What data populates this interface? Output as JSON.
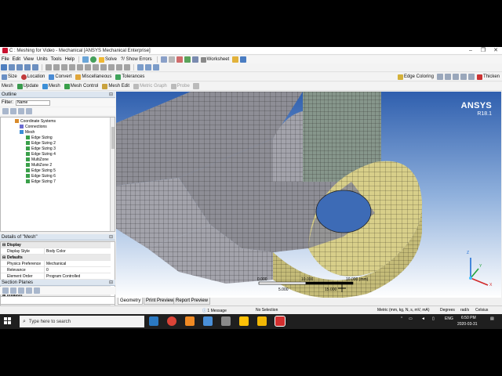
{
  "window": {
    "title": "C : Meshing for Video - Mechanical [ANSYS Mechanical Enterprise]",
    "controls": [
      "–",
      "❐",
      "✕"
    ]
  },
  "menubar": [
    "File",
    "Edit",
    "View",
    "Units",
    "Tools",
    "Help"
  ],
  "toolbar1": {
    "solve": "Solve",
    "show_errors": "?/ Show Errors",
    "worksheet": "Worksheet"
  },
  "toolbar2": {
    "size": "Size",
    "location": "Location",
    "convert": "Convert",
    "miscellaneous": "Miscellaneous",
    "tolerances": "Tolerances",
    "edge_coloring": "Edge Coloring",
    "thicken": "Thicken"
  },
  "toolbar3": {
    "mesh": "Mesh",
    "update": "Update",
    "mesh_menu": "Mesh",
    "mesh_control": "Mesh Control",
    "mesh_edit": "Mesh Edit",
    "metric_graph": "Metric Graph",
    "probe": "Probe"
  },
  "outline": {
    "title": "Outline",
    "filter_label": "Filter:",
    "filter_value": "Name",
    "nodes": [
      {
        "label": "Coordinate Systems",
        "color": "#d88a2b"
      },
      {
        "label": "Connections",
        "color": "#6b6bd1"
      },
      {
        "label": "Mesh",
        "color": "#3d8fd6"
      },
      {
        "label": "Edge Sizing",
        "color": "#3aa04a"
      },
      {
        "label": "Edge Sizing 2",
        "color": "#3aa04a"
      },
      {
        "label": "Edge Sizing 3",
        "color": "#3aa04a"
      },
      {
        "label": "Edge Sizing 4",
        "color": "#3aa04a"
      },
      {
        "label": "MultiZone",
        "color": "#3aa04a"
      },
      {
        "label": "MultiZone 2",
        "color": "#3aa04a"
      },
      {
        "label": "Edge Sizing 5",
        "color": "#3aa04a"
      },
      {
        "label": "Edge Sizing 6",
        "color": "#3aa04a"
      },
      {
        "label": "Edge Sizing 7",
        "color": "#3aa04a"
      }
    ]
  },
  "details": {
    "title": "Details of \"Mesh\"",
    "rows": [
      {
        "type": "section",
        "label": "Display",
        "expander": "⊟"
      },
      {
        "type": "prop",
        "key": "Display Style",
        "value": "Body Color"
      },
      {
        "type": "section",
        "label": "Defaults",
        "expander": "⊟"
      },
      {
        "type": "prop",
        "key": "Physics Preference",
        "value": "Mechanical"
      },
      {
        "type": "prop",
        "key": "Relevance",
        "value": "0"
      },
      {
        "type": "prop",
        "key": "Element Order",
        "value": "Program Controlled"
      },
      {
        "type": "section",
        "label": "Sizing",
        "expander": "⊞"
      },
      {
        "type": "section",
        "label": "Quality",
        "expander": "⊞"
      },
      {
        "type": "section",
        "label": "Inflation",
        "expander": "⊞"
      },
      {
        "type": "section",
        "label": "Advanced",
        "expander": "⊞"
      },
      {
        "type": "section",
        "label": "Statistics",
        "expander": "⊞"
      }
    ]
  },
  "section_planes": {
    "title": "Section Planes"
  },
  "viewport": {
    "logo": "ANSYS",
    "version": "R18.1",
    "scale": {
      "left": "0.000",
      "mid_top": "10.000",
      "right": "10.000 (mm)",
      "mid_bottom": "5.000",
      "right_bottom": "15.000"
    },
    "mesh_color_gray": "#8d8d94",
    "mesh_color_yellow": "#d8cf8a",
    "axes": {
      "x": "X",
      "y": "Y",
      "z": "Z"
    }
  },
  "tabs": [
    "Geometry",
    "Print Preview",
    "Report Preview"
  ],
  "status": {
    "messages": "1 Message",
    "selection": "No Selection",
    "units": "Metric (mm, kg, N, s, mV, mA)",
    "angle": "Degrees",
    "rate": "rad/s",
    "temp": "Celsius"
  },
  "taskbar": {
    "search_placeholder": "Type here to search",
    "lang": "ENG",
    "time": "6:50 PM",
    "date": "2020-03-31"
  }
}
